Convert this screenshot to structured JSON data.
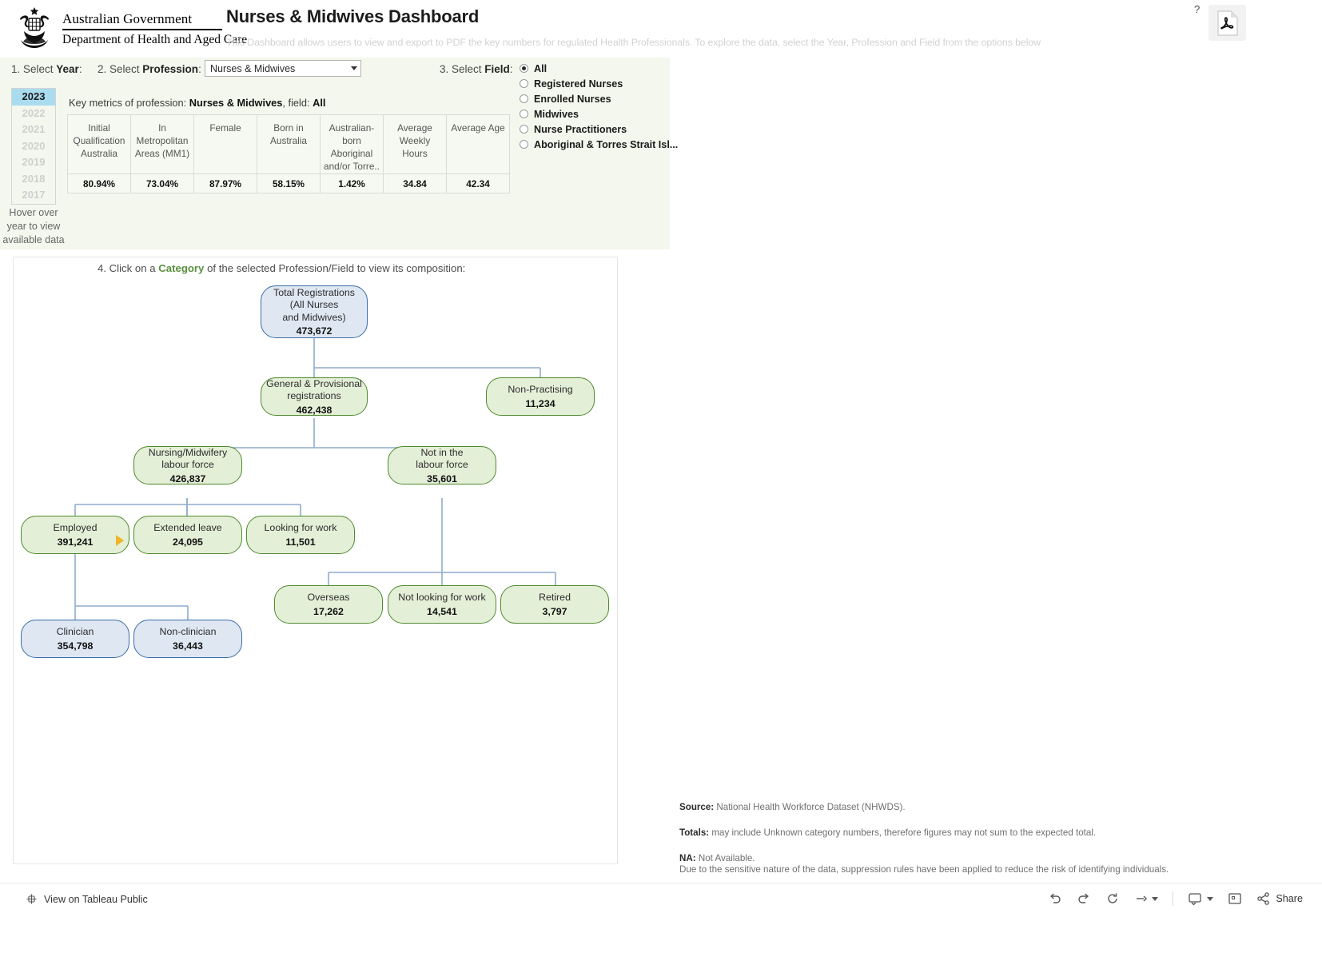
{
  "header": {
    "gov_line1": "Australian Government",
    "gov_line2": "Department of Health and Aged Care",
    "title": "Nurses & Midwives Dashboard",
    "subtitle": "This Dashboard allows users to view and export to PDF the key numbers for regulated Health Professionals.  To explore the data, select the Year, Profession and Field from the options below",
    "help_icon": "?",
    "pdf_icon": "pdf-export-icon",
    "crest_icon": "australian-coat-of-arms"
  },
  "controls": {
    "year_label_num": "1. Select ",
    "year_label_bold": "Year",
    "year_label_colon": ":",
    "profession_label_num": "2. Select ",
    "profession_label_bold": "Profession",
    "profession_label_colon": ":",
    "field_label_num": "3. Select ",
    "field_label_bold": "Field",
    "field_label_colon": ":",
    "profession_selected": "Nurses & Midwives",
    "years": [
      {
        "label": "2023",
        "selected": true
      },
      {
        "label": "2022",
        "selected": false
      },
      {
        "label": "2021",
        "selected": false
      },
      {
        "label": "2020",
        "selected": false
      },
      {
        "label": "2019",
        "selected": false
      },
      {
        "label": "2018",
        "selected": false
      },
      {
        "label": "2017",
        "selected": false
      }
    ],
    "year_hint": "Hover over year to view available data",
    "fields": [
      {
        "label": "All",
        "selected": true
      },
      {
        "label": "Registered Nurses",
        "selected": false
      },
      {
        "label": "Enrolled Nurses",
        "selected": false
      },
      {
        "label": "Midwives",
        "selected": false
      },
      {
        "label": "Nurse Practitioners",
        "selected": false
      },
      {
        "label": "Aboriginal & Torres Strait Isl...",
        "selected": false
      }
    ]
  },
  "key_metrics": {
    "title_prefix": "Key metrics of profession: ",
    "title_profession": "Nurses & Midwives",
    "title_mid": ", field: ",
    "title_field": "All",
    "columns": [
      "Initial Qualification Australia",
      "In Metropolitan Areas (MM1)",
      "Female",
      "Born in Australia",
      "Australian-born Aboriginal and/or Torre..",
      "Average Weekly Hours",
      "Average Age"
    ],
    "values": [
      "80.94%",
      "73.04%",
      "87.97%",
      "58.15%",
      "1.42%",
      "34.84",
      "42.34"
    ]
  },
  "flowchart": {
    "instruction_pre": "4. Click on a ",
    "instruction_bold": "Category",
    "instruction_post": " of the selected Profession/Field to view its composition:",
    "nodes": [
      {
        "id": "total",
        "label": "Total Registrations\n(All Nurses\nand Midwives)",
        "value": "473,672",
        "style": "blue"
      },
      {
        "id": "general",
        "label": "General & Provisional\nregistrations",
        "value": "462,438",
        "style": "green"
      },
      {
        "id": "nonprac",
        "label": "Non-Practising",
        "value": "11,234",
        "style": "green"
      },
      {
        "id": "labourforce",
        "label": "Nursing/Midwifery\nlabour force",
        "value": "426,837",
        "style": "green"
      },
      {
        "id": "notinlabour",
        "label": "Not in the\nlabour force",
        "value": "35,601",
        "style": "green"
      },
      {
        "id": "employed",
        "label": "Employed",
        "value": "391,241",
        "style": "green"
      },
      {
        "id": "extleave",
        "label": "Extended leave",
        "value": "24,095",
        "style": "green"
      },
      {
        "id": "looking",
        "label": "Looking for work",
        "value": "11,501",
        "style": "green"
      },
      {
        "id": "overseas",
        "label": "Overseas",
        "value": "17,262",
        "style": "green"
      },
      {
        "id": "notlooking",
        "label": "Not looking for work",
        "value": "14,541",
        "style": "green"
      },
      {
        "id": "retired",
        "label": "Retired",
        "value": "3,797",
        "style": "green"
      },
      {
        "id": "clinician",
        "label": "Clinician",
        "value": "354,798",
        "style": "blue"
      },
      {
        "id": "nonclinician",
        "label": "Non-clinician",
        "value": "36,443",
        "style": "blue"
      }
    ]
  },
  "notes": {
    "source_bold": "Source:",
    "source_text": " National Health Workforce Dataset (NHWDS).",
    "totals_bold": "Totals:",
    "totals_text": " may include Unknown category numbers, therefore figures may not sum to the expected total.",
    "na_bold": "NA:",
    "na_text": " Not Available.",
    "suppression_text": "Due to the sensitive nature of the data, suppression rules have been applied to reduce the risk of identifying individuals."
  },
  "bottombar": {
    "tableau_public_label": "View on Tableau Public",
    "share_label": "Share",
    "icons": [
      "tableau-logo-icon",
      "undo-icon",
      "redo-icon",
      "revert-icon",
      "pause-icon",
      "refresh-icon",
      "fullscreen-icon",
      "share-icon"
    ]
  },
  "colors": {
    "band_bg": "#f4f7ed",
    "year_selected": "#aadcf0",
    "green_node_fill": "#e4efd7",
    "green_node_border": "#4f8a2f",
    "blue_node_fill": "#dfe7f2",
    "blue_node_border": "#3c6ea5",
    "connector": "#8faccd",
    "drill_marker": "#f0b429",
    "category_word": "#5a8f3d"
  }
}
